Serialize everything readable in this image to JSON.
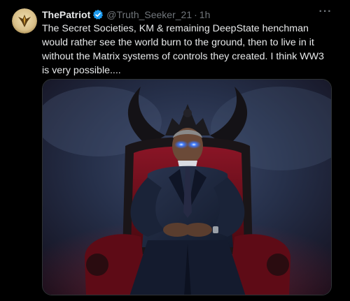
{
  "tweet": {
    "display_name": "ThePatriot",
    "handle": "@Truth_Seeker_21",
    "separator": "·",
    "time": "1h",
    "more_label": "···",
    "text": "The Secret Societies, KM & remaining DeepState henchman\nwould rather see the world burn to the ground, then to live in it\nwithout the Matrix systems of controls they created. I think WW3\nis very possible....",
    "verified_icon": "verified-badge-icon",
    "avatar_icon": "phoenix-logo-avatar",
    "media": {
      "kind": "image",
      "subject": "man-in-suit-on-horned-throne"
    }
  },
  "colors": {
    "background": "#000000",
    "primary_text": "#e7e9ea",
    "secondary_text": "#71767b",
    "verified_blue": "#1d9bf0",
    "border": "#2f3336",
    "throne_red": "#7a1020",
    "eye_glow": "#2f6bff"
  }
}
